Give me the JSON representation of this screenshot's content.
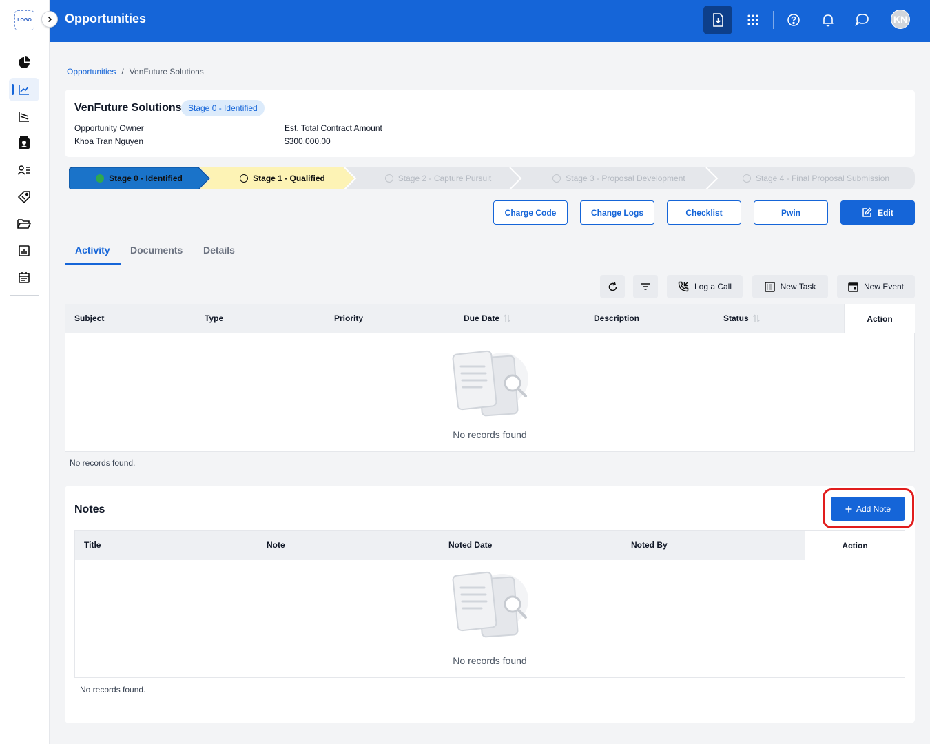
{
  "app": {
    "logo_text": "LOGO",
    "page_title": "Opportunities",
    "avatar_initials": "KN"
  },
  "sidebar": {
    "items": [
      {
        "name": "dashboard-icon"
      },
      {
        "name": "opportunities-icon",
        "active": true
      },
      {
        "name": "pipeline-icon"
      },
      {
        "name": "contacts-icon"
      },
      {
        "name": "users-list-icon"
      },
      {
        "name": "tags-icon"
      },
      {
        "name": "folder-icon"
      },
      {
        "name": "reports-icon"
      },
      {
        "name": "calendar-icon"
      }
    ]
  },
  "header": {
    "icons": [
      "download-doc-icon",
      "apps-grid-icon",
      "help-icon",
      "bell-icon",
      "chat-icon"
    ]
  },
  "breadcrumb": {
    "root": "Opportunities",
    "separator": "/",
    "current": "VenFuture Solutions"
  },
  "opportunity": {
    "name": "VenFuture Solutions",
    "stage_badge": "Stage 0 - Identified",
    "owner_label": "Opportunity Owner",
    "owner_value": "Khoa Tran Nguyen",
    "amount_label": "Est. Total Contract Amount",
    "amount_value": "$300,000.00"
  },
  "stages": [
    {
      "label": "Stage 0 - Identified",
      "state": "complete"
    },
    {
      "label": "Stage 1 - Qualified",
      "state": "current"
    },
    {
      "label": "Stage 2 - Capture Pursuit",
      "state": "upcoming"
    },
    {
      "label": "Stage 3 - Proposal Development",
      "state": "upcoming"
    },
    {
      "label": "Stage 4 - Final Proposal Submission",
      "state": "upcoming"
    }
  ],
  "actions": {
    "charge_code": "Charge Code",
    "change_logs": "Change Logs",
    "checklist": "Checklist",
    "pwin": "Pwin",
    "edit": "Edit"
  },
  "tabs": [
    {
      "label": "Activity",
      "active": true
    },
    {
      "label": "Documents"
    },
    {
      "label": "Details"
    }
  ],
  "activity": {
    "toolbar": {
      "log_call": "Log a Call",
      "new_task": "New Task",
      "new_event": "New Event"
    },
    "columns": [
      "Subject",
      "Type",
      "Priority",
      "Due Date",
      "Description",
      "Status"
    ],
    "action_column": "Action",
    "empty_text": "No records found",
    "footer_text": "No records found."
  },
  "notes": {
    "title": "Notes",
    "add_button": "Add Note",
    "columns": [
      "Title",
      "Note",
      "Noted Date",
      "Noted By"
    ],
    "action_column": "Action",
    "empty_text": "No records found",
    "footer_text": "No records found."
  },
  "colors": {
    "primary": "#1565d8",
    "stage_complete": "#1a73c9",
    "stage_current": "#fdf3b5",
    "stage_upcoming": "#e5e7eb",
    "highlight": "#e11d1d"
  }
}
